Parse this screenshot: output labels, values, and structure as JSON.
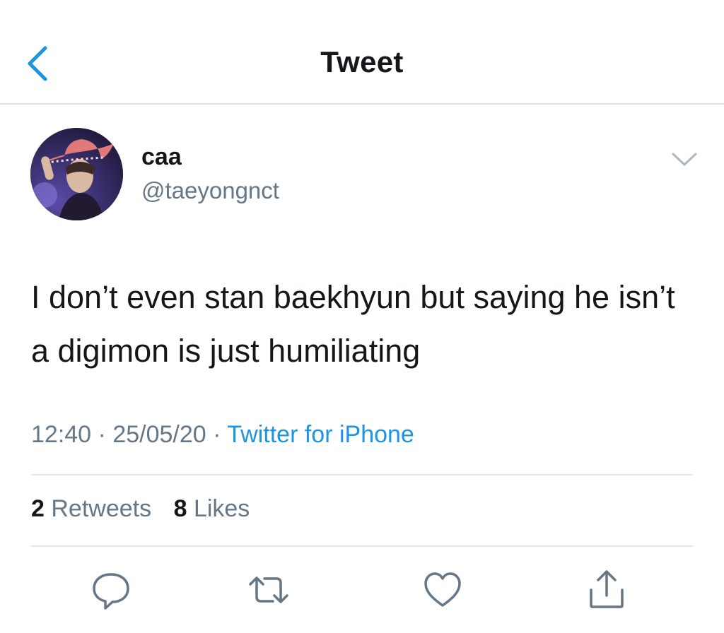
{
  "header": {
    "title": "Tweet",
    "back_icon": "chevron-left-icon"
  },
  "author": {
    "name": "caa",
    "handle": "@taeyongnct",
    "avatar": "avatar-image",
    "menu_icon": "chevron-down-icon"
  },
  "tweet": {
    "text": "I don’t even stan baekhyun but saying he isn’t a digimon is just humiliating",
    "time": "12:40",
    "date": "25/05/20",
    "source": "Twitter for iPhone"
  },
  "stats": {
    "retweets_count": "2",
    "retweets_label": "Retweets",
    "likes_count": "8",
    "likes_label": "Likes"
  },
  "actions": [
    "reply-icon",
    "retweet-icon",
    "like-icon",
    "share-icon"
  ],
  "colors": {
    "accent": "#1b95e0",
    "text": "#14171a",
    "secondary": "#657786",
    "divider": "#e1e8ed"
  }
}
